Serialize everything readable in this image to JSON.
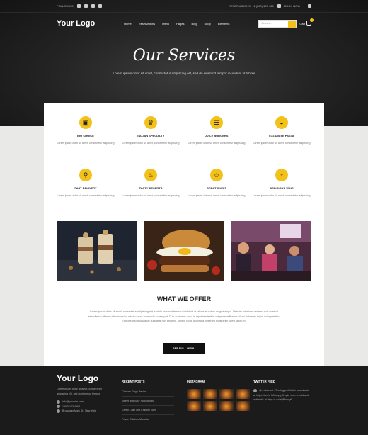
{
  "topbar": {
    "follow": "FOLLOW US",
    "reservations": "RESERVATIONS: +1 (800) 123 456",
    "book": "BOOK NOW",
    "social_icons": [
      "twitter-icon",
      "facebook-icon",
      "instagram-icon",
      "youtube-icon"
    ]
  },
  "nav": {
    "logo": "Your Logo",
    "items": [
      "Home",
      "Reservations",
      "Menu",
      "Pages",
      "Blog",
      "Shop",
      "Elements"
    ],
    "search_placeholder": "Search...",
    "cart_label": "Cart"
  },
  "hero": {
    "title": "Our Services",
    "subtitle": "Lorem ipsum dolor sit amet, consectetur adipiscing elit, sed do eiusmod tempor incididunt ut labore"
  },
  "services": [
    {
      "title": "BIG CHOICE",
      "desc": "Lorem ipsum dolor sit amet, consectetur adipiscing",
      "icon": "bag-icon"
    },
    {
      "title": "ITALIAN SPECIALTY",
      "desc": "Lorem ipsum dolor sit amet, consectetur adipiscing",
      "icon": "chef-hat-icon"
    },
    {
      "title": "JUICY BURGERS",
      "desc": "Lorem ipsum dolor sit amet, consectetur adipiscing",
      "icon": "burger-icon"
    },
    {
      "title": "EXQUISITE PASTA",
      "desc": "Lorem ipsum dolor sit amet, consectetur adipiscing",
      "icon": "pasta-icon"
    },
    {
      "title": "FAST DELIVERY",
      "desc": "Lorem ipsum dolor sit amet, consectetur adipiscing",
      "icon": "scooter-icon"
    },
    {
      "title": "TASTY DESERTS",
      "desc": "Lorem ipsum dolor sit amet, consectetur adipiscing",
      "icon": "cupcake-icon"
    },
    {
      "title": "GREAT CHEFS",
      "desc": "Lorem ipsum dolor sit amet, consectetur adipiscing",
      "icon": "chef-icon"
    },
    {
      "title": "DELICIOUS WINE",
      "desc": "Lorem ipsum dolor sit amet, consectetur adipiscing",
      "icon": "wine-icon"
    }
  ],
  "offer": {
    "title": "WHAT WE OFFER",
    "text": "Lorem ipsum dolor sit amet, consectetur adipiscing elit, sed do eiusmod tempor incididunt ut labore et dolore magna aliqua. Ut enim ad minim veniam, quis nostrud exercitation ullamco laboris nisi ut aliquip ex ea commodo consequat. Duis aute irure dolor in reprehenderit in voluptate velit esse cillum dolore eu fugiat nulla pariatur. Excepteur sint occaecat cupidatat non proident, sunt in culpa qui officia deserunt mollit anim id est laborum.",
    "button": "SEE FULL MENU"
  },
  "footer": {
    "logo": "Your Logo",
    "about": "Lorem ipsum dolor sit amet, consectetur adipiscing elit, sed do eiusmod tempor.",
    "email": "info@yoursite.com",
    "phone": "1 800 123 4567",
    "address": "Broadway Main St., New York",
    "recent_title": "RECENT POSTS",
    "recent": [
      "Chicken Tinga Recipe",
      "Sweet and Sour Pork Wings",
      "Green Chile and Chicken Stew",
      "Pesce Chicken Marsala"
    ],
    "instagram_title": "INSTAGRAM",
    "twitter_title": "TWITTER FEED",
    "tweet": "@restaurant - The biggest Hatch is available at https://t.co/xHVMabpq Simple open a bold and authentic at https://t.co/aQMnpcy6"
  },
  "colors": {
    "accent": "#f2c21b",
    "dark": "#1b1b1b",
    "paper": "#ffffff"
  }
}
